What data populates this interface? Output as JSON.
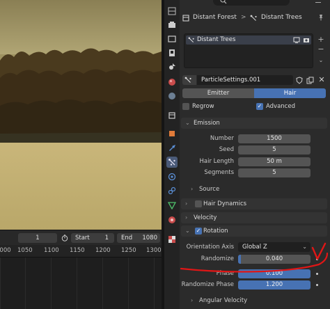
{
  "timeline": {
    "current_frame": "1",
    "start_label": "Start",
    "start_value": "1",
    "end_label": "End",
    "end_value": "1080",
    "ruler_ticks": [
      "1000",
      "1050",
      "1100",
      "1150",
      "1200",
      "1250",
      "1300"
    ]
  },
  "header": {
    "search_placeholder": "",
    "breadcrumb_object": "Distant Forest",
    "breadcrumb_separator": ">",
    "breadcrumb_system": "Distant Trees"
  },
  "particle_list": {
    "items": [
      {
        "label": "Distant Trees"
      }
    ]
  },
  "settings_block": {
    "name": "ParticleSettings.001"
  },
  "type_toggle": {
    "emitter": "Emitter",
    "hair": "Hair",
    "selected": "Hair"
  },
  "options": {
    "regrow": {
      "label": "Regrow",
      "checked": false
    },
    "advanced": {
      "label": "Advanced",
      "checked": true
    }
  },
  "emission": {
    "title": "Emission",
    "number_label": "Number",
    "number_value": "1500",
    "seed_label": "Seed",
    "seed_value": "5",
    "hair_length_label": "Hair Length",
    "hair_length_value": "50 m",
    "segments_label": "Segments",
    "segments_value": "5",
    "source_title": "Source"
  },
  "hair_dynamics": {
    "title": "Hair Dynamics"
  },
  "velocity": {
    "title": "Velocity"
  },
  "rotation": {
    "title": "Rotation",
    "orientation_axis_label": "Orientation Axis",
    "orientation_axis_value": "Global Z",
    "randomize_label": "Randomize",
    "randomize_value": "0.040",
    "phase_label": "Phase",
    "phase_value": "0.100",
    "randomize_phase_label": "Randomize Phase",
    "randomize_phase_value": "1.200",
    "angular_velocity_title": "Angular Velocity"
  },
  "annotation": {
    "color": "#e01616"
  },
  "colors": {
    "accent": "#4772b3",
    "panel": "#2b2b2b"
  }
}
